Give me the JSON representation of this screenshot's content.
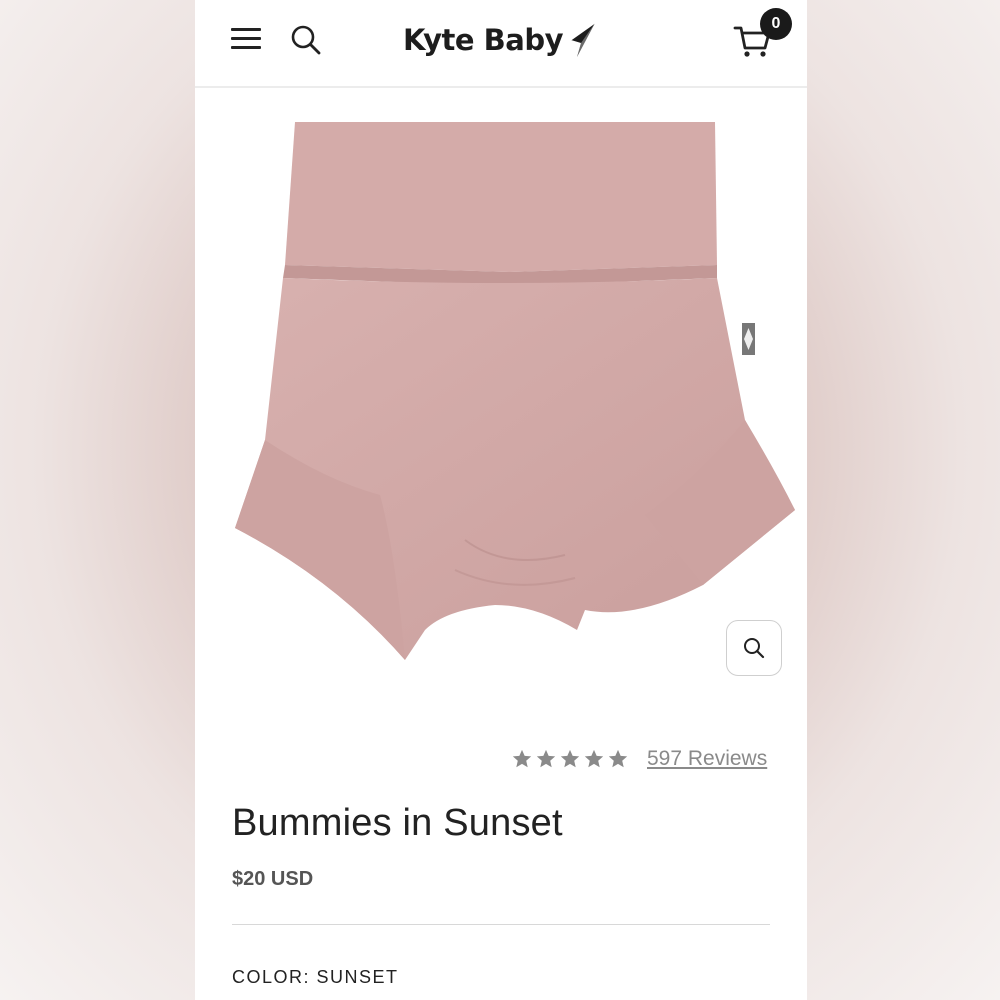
{
  "header": {
    "brand": "Kyte Baby",
    "cart_count": "0"
  },
  "icons": {
    "menu": "hamburger-menu-icon",
    "search": "magnifier-search-icon",
    "cart": "shopping-cart-icon",
    "zoom": "magnifier-zoom-icon",
    "star": "star-icon"
  },
  "product": {
    "image_alt": "Bummies in Sunset",
    "rating": 5,
    "reviews_label": "597 Reviews",
    "title": "Bummies in Sunset",
    "price": "$20 USD",
    "color_label": "COLOR:",
    "color_value": "SUNSET"
  },
  "colors": {
    "fabric": "#d2a9a7",
    "text": "#222222",
    "muted": "#8a8a8a"
  }
}
